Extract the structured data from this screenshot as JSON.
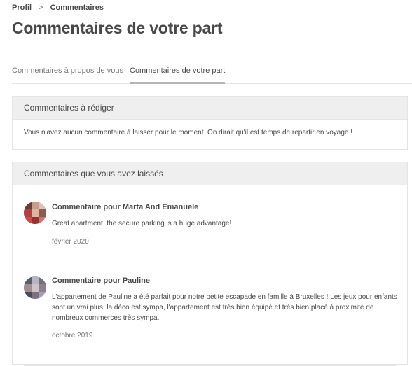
{
  "breadcrumb": {
    "parent": "Profil",
    "separator": ">",
    "current": "Commentaires"
  },
  "page_title": "Commentaires de votre part",
  "tabs": [
    {
      "label": "Commentaires à propos de vous",
      "active": false
    },
    {
      "label": "Commentaires de votre part",
      "active": true
    }
  ],
  "to_write": {
    "header": "Commentaires à rédiger",
    "message": "Vous n'avez aucun commentaire à laisser pour le moment. On dirait qu'il est temps de repartir en voyage !"
  },
  "left": {
    "header": "Commentaires que vous avez laissés",
    "reviews": [
      {
        "title": "Commentaire pour Marta And Emanuele",
        "text": "Great apartment, the secure parking is a huge advantage!",
        "date": "février 2020"
      },
      {
        "title": "Commentaire pour Pauline",
        "text": "L'appartement de Pauline a été parfait pour notre petite escapade en famille à Bruxelles ! Les jeux pour enfants sont un vrai plus, la déco est sympa, l'appartement est très bien équipé et très bien placé à proximité de nombreux commerces très sympa.",
        "date": "octobre 2019"
      }
    ]
  },
  "colors": {
    "text": "#484848",
    "muted": "#767676",
    "header_bg": "#efefef",
    "border": "#e4e4e4"
  }
}
